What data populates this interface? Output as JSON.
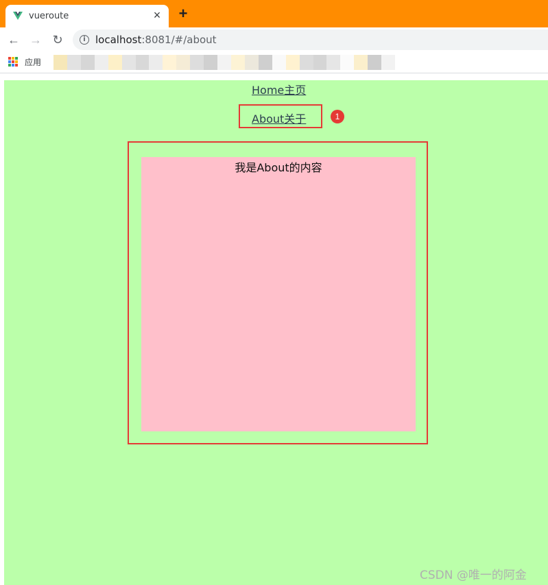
{
  "browser": {
    "tab_title": "vueroute",
    "tab_close": "×",
    "new_tab": "+",
    "url_host": "localhost",
    "url_rest": ":8081/#/about",
    "bookmarks_apps_label": "应用"
  },
  "nav": {
    "home_link": "Home主页",
    "about_link": "About关于",
    "badge": "1"
  },
  "content": {
    "about_text": "我是About的内容"
  },
  "watermark": "CSDN @唯一的阿金",
  "colors": {
    "tabstrip": "#ff8c00",
    "page_background": "#bbffaa",
    "content_background": "#ffc0cb",
    "highlight": "#e53935"
  }
}
